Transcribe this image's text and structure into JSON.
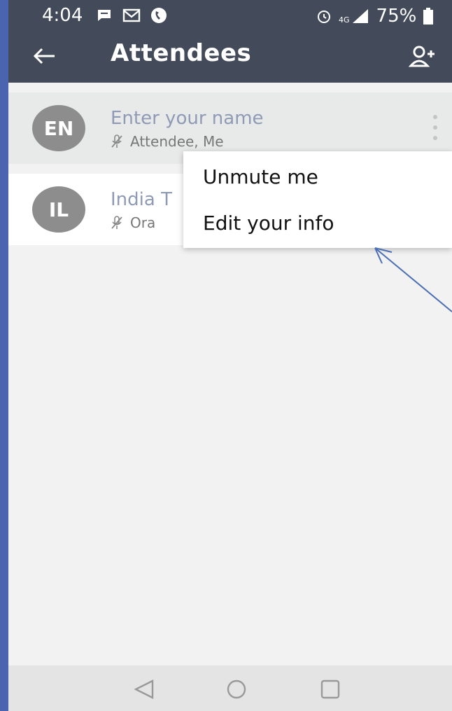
{
  "status_bar": {
    "time": "4:04",
    "network": "4G",
    "battery": "75%"
  },
  "app_bar": {
    "title": "Attendees"
  },
  "attendees": [
    {
      "initials": "EN",
      "name": "Enter your name",
      "role": "Attendee, Me"
    },
    {
      "initials": "IL",
      "name": "India T",
      "role": "Ora"
    }
  ],
  "context_menu": {
    "items": [
      "Unmute me",
      "Edit your info"
    ]
  },
  "colors": {
    "app_bar": "#434b5a",
    "background": "#f2f2f2",
    "avatar": "#8d8d8d",
    "annotation_arrow": "#4a6fb3",
    "slide_background": "#4a64b0"
  }
}
